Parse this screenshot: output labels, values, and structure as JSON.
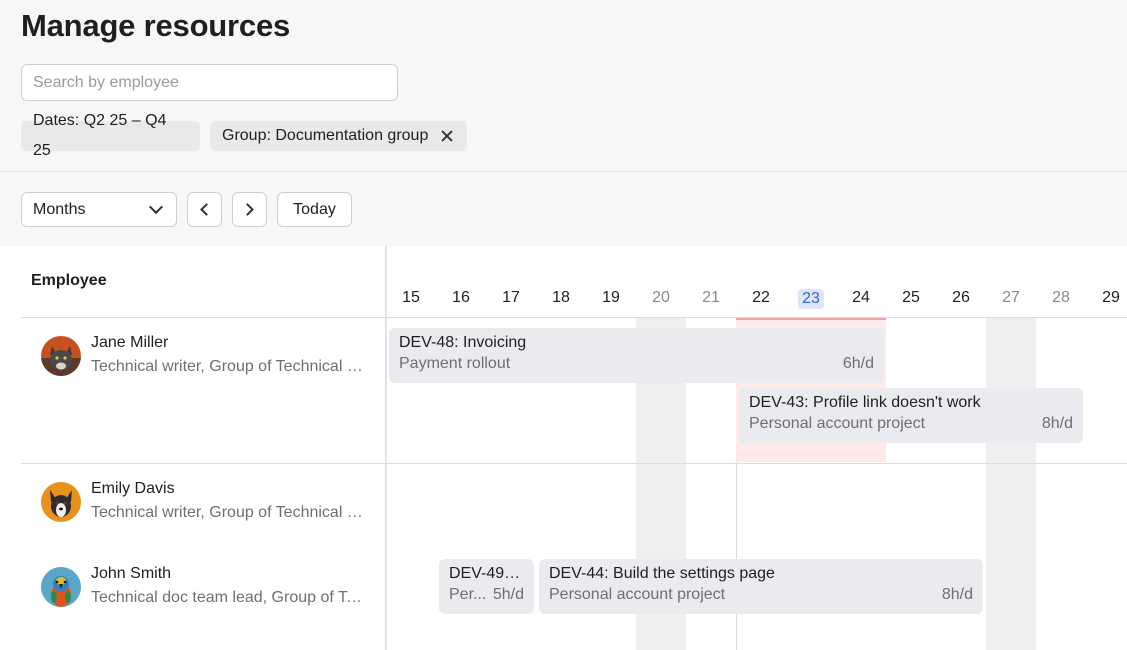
{
  "page": {
    "title": "Manage resources"
  },
  "search": {
    "placeholder": "Search by employee"
  },
  "filters": {
    "dates": "Dates: Q2 25 – Q4 25",
    "group": "Group: Documentation group"
  },
  "toolbar": {
    "view": "Months",
    "today": "Today"
  },
  "table": {
    "employee_header": "Employee",
    "days": [
      {
        "label": "15",
        "weekend": false
      },
      {
        "label": "16",
        "weekend": false
      },
      {
        "label": "17",
        "weekend": false
      },
      {
        "label": "18",
        "weekend": false
      },
      {
        "label": "19",
        "weekend": false
      },
      {
        "label": "20",
        "weekend": true
      },
      {
        "label": "21",
        "weekend": true
      },
      {
        "label": "22",
        "weekend": false
      },
      {
        "label": "23",
        "weekend": false,
        "today": true
      },
      {
        "label": "24",
        "weekend": false
      },
      {
        "label": "25",
        "weekend": false
      },
      {
        "label": "26",
        "weekend": false
      },
      {
        "label": "27",
        "weekend": true
      },
      {
        "label": "28",
        "weekend": true
      },
      {
        "label": "29",
        "weekend": false
      }
    ]
  },
  "employees": [
    {
      "name": "Jane Miller",
      "role": "Technical writer, Group of Technical Writers",
      "avatar": "cat-avatar"
    },
    {
      "name": "Emily Davis",
      "role": "Technical writer, Group of Technical Writers",
      "avatar": "dog-avatar"
    },
    {
      "name": "John Smith",
      "role": "Technical doc team lead, Group of Technical Writers",
      "avatar": "parrot-avatar"
    }
  ],
  "tasks": [
    {
      "title": "DEV-48: Invoicing",
      "project": "Payment rollout",
      "hours": "6h/d"
    },
    {
      "title": "DEV-43: Profile link doesn't work",
      "project": "Personal account project",
      "hours": "8h/d"
    },
    {
      "title": "DEV-49: ...",
      "project": "Per...",
      "hours": "5h/d"
    },
    {
      "title": "DEV-44: Build the settings page",
      "project": "Personal account project",
      "hours": "8h/d"
    }
  ],
  "colors": {
    "today_highlight": "#ffe9e9",
    "today_marker": "#f2a29a",
    "task_bg": "#e9ebee",
    "weekend_bg": "#efefef"
  }
}
